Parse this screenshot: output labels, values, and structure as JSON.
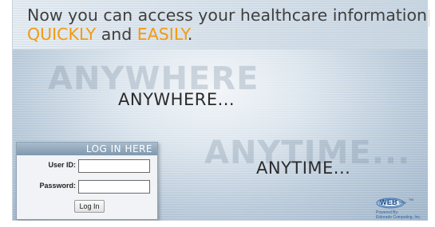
{
  "header": {
    "line1": "Now you can access your healthcare information",
    "quickly": "QUICKLY",
    "and": " and ",
    "easily": "EASILY",
    "period": "."
  },
  "taglines": {
    "anywhere_ghost": "ANYWHERE",
    "anywhere": "ANYWHERE...",
    "anytime_ghost": "ANYTIME...",
    "anytime": "ANYTIME..."
  },
  "login": {
    "title": "LOG IN HERE",
    "user_label": "User ID:",
    "user_value": "",
    "password_label": "Password:",
    "password_value": "",
    "button_label": "Log In"
  },
  "logo": {
    "wordmark": "WEB",
    "submark": "PTS",
    "tm": "TM",
    "powered_by": "Powered By:",
    "company": "Eldorado Computing, Inc."
  },
  "colors": {
    "accent": "#f39a10",
    "headline": "#3f3f3f",
    "login_header": "#8ea2b6"
  }
}
